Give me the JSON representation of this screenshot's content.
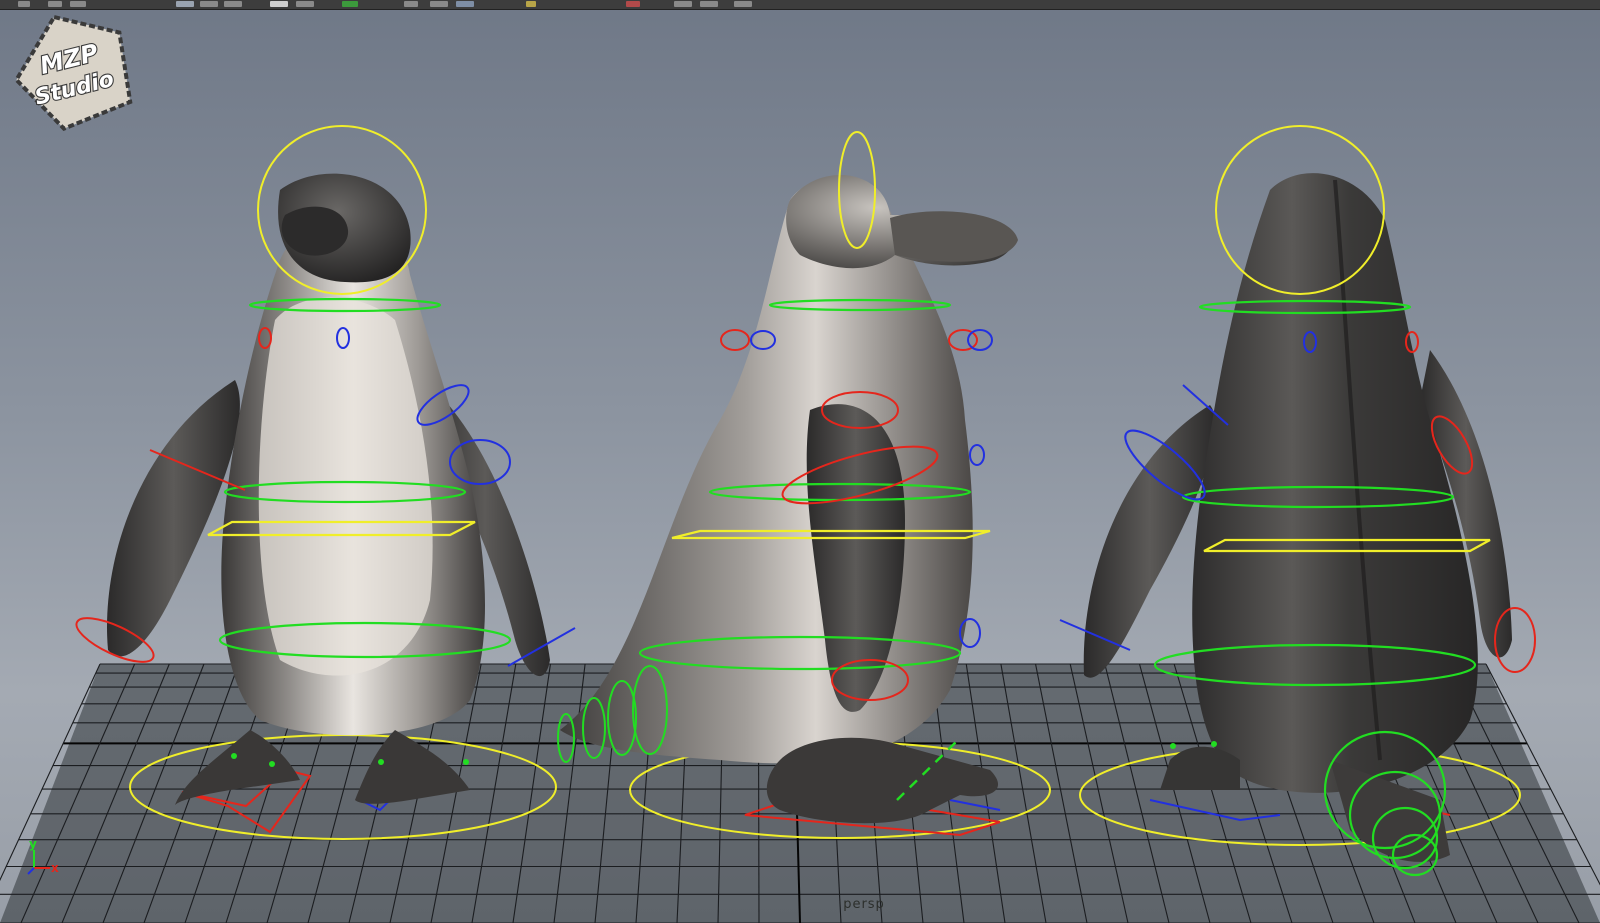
{
  "app": {
    "logo_line1": "MZP",
    "logo_line2": "Studio",
    "camera_name": "persp",
    "axis_y": "y",
    "axis_x": "x"
  },
  "toolbar": {
    "icons": [
      "select-icon",
      "lasso-icon",
      "paint-icon",
      "move-icon",
      "rotate-icon",
      "scale-icon",
      "snap-grid-icon",
      "snap-curve-icon",
      "snap-point-icon",
      "render-icon",
      "ipr-render-icon",
      "render-settings-icon",
      "sound-icon",
      "camera-icon",
      "layout-icon"
    ]
  },
  "scene": {
    "models": [
      {
        "name": "penguin-front-view",
        "view": "front"
      },
      {
        "name": "penguin-side-view",
        "view": "side"
      },
      {
        "name": "penguin-back-view",
        "view": "back"
      }
    ],
    "control_colors": {
      "head": "#f0ee2a",
      "spine": "#22dd22",
      "left": "#e5261c",
      "right": "#2230e0",
      "root": "#e9e22c",
      "grid": "#1b1d20",
      "grid_axis": "#050505"
    }
  }
}
